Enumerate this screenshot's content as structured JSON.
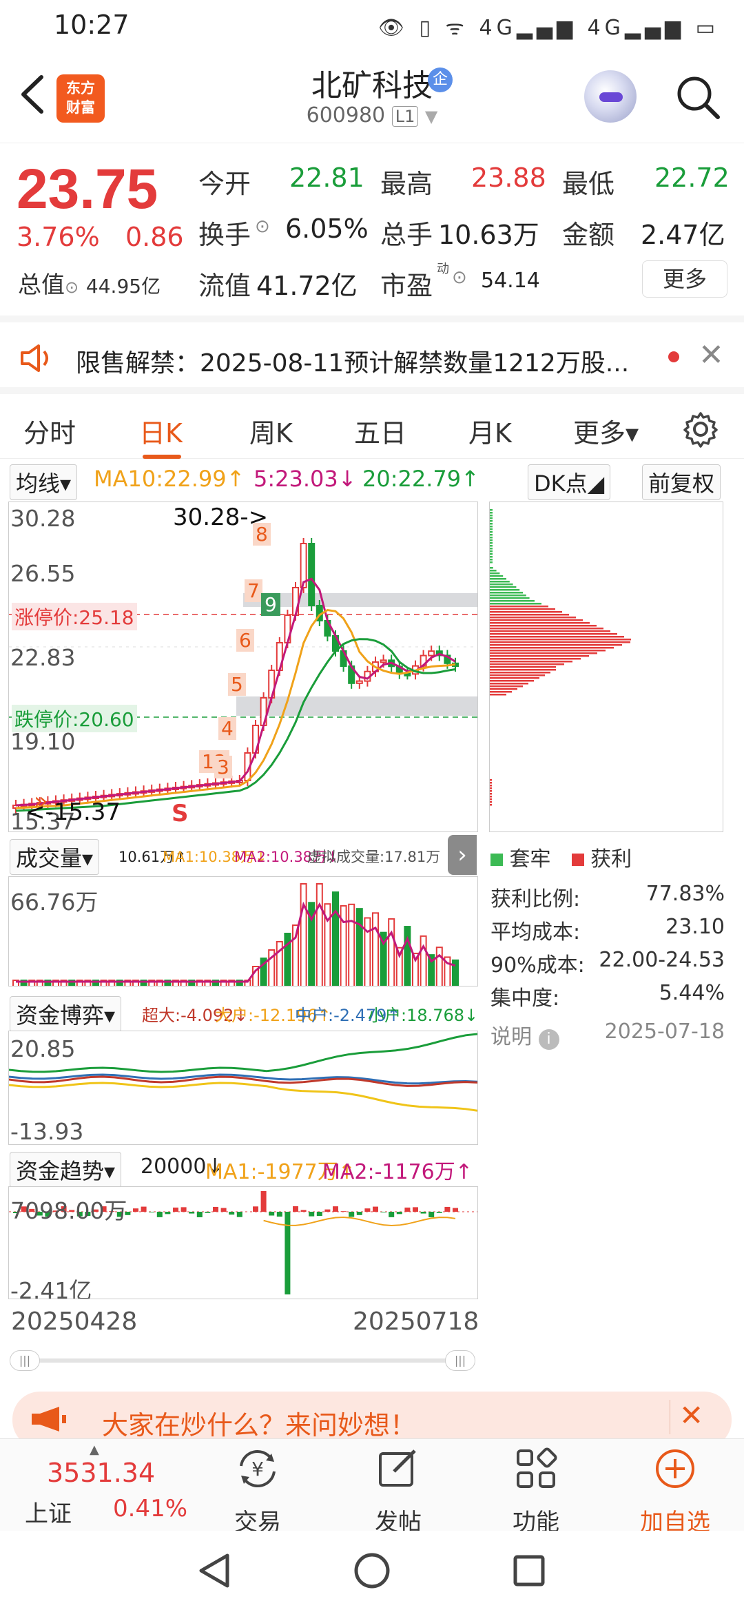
{
  "status_bar": {
    "time": "10:27",
    "icons": "👁 ▯ ᯤ 4G▂▄▆ 4G▂▄▆ ▭"
  },
  "header": {
    "stock_name": "北矿科技",
    "badge": "企",
    "code": "600980",
    "level": "L1",
    "logo_line1": "东方",
    "logo_line2": "财富"
  },
  "quote": {
    "price": "23.75",
    "change_pct": "3.76%",
    "change_amt": "0.86",
    "open_label": "今开",
    "open": "22.81",
    "high_label": "最高",
    "high": "23.88",
    "low_label": "最低",
    "low": "22.72",
    "turnover_label": "换手",
    "turnover": "6.05%",
    "volume_label": "总手",
    "volume": "10.63万",
    "amount_label": "金额",
    "amount": "2.47亿",
    "mktcap_label": "总值",
    "mktcap": "44.95亿",
    "float_label": "流值",
    "float_cap": "41.72亿",
    "pe_label": "市盈",
    "pe_sup": "动",
    "pe": "54.14",
    "more": "更多"
  },
  "notice": {
    "text": "限售解禁：2025-08-11预计解禁数量1212万股...",
    "close": "✕"
  },
  "tabs": [
    {
      "label": "分时"
    },
    {
      "label": "日K"
    },
    {
      "label": "周K"
    },
    {
      "label": "五日"
    },
    {
      "label": "月K"
    },
    {
      "label": "更多▾"
    }
  ],
  "ma_row": {
    "selector": "均线▾",
    "ma10": "MA10:22.99↑",
    "ma5": "5:23.03↓",
    "ma20": "20:22.79↑",
    "dk": "DK点◢",
    "adjust": "前复权"
  },
  "kline": {
    "ymax_label": "30.28",
    "y2_label": "26.55",
    "y3_label": "22.83",
    "y4_label": "19.10",
    "ymin_label": "15.37",
    "peak_note": "30.28->",
    "min_note": "<-15.37",
    "limit_up": "涨停价:25.18",
    "limit_down": "跌停价:20.60",
    "markers": [
      "8",
      "7",
      "9",
      "6",
      "5",
      "4",
      "12",
      "3",
      "S"
    ]
  },
  "volume": {
    "selector": "成交量▾",
    "info": "10.61万↑",
    "ma1": "MA1:10.38万↓",
    "ma2": "MA2:10.38万↓",
    "virtual": "虚拟成交量:17.81万",
    "max_label": "66.76万"
  },
  "capital_game": {
    "selector": "资金博弈▾",
    "super": "超大:-4.092↓",
    "large": "大户:-12.196↑",
    "mid": "中户:-2.479↑",
    "small": "小户:18.768↓",
    "max_label": "20.85",
    "min_label": "-13.93"
  },
  "capital_trend": {
    "selector": "资金趋势▾",
    "val": "20000↓",
    "ma1": "MA1:-1977万↑",
    "ma2": "MA2:-1176万↑",
    "max_label": "7098.00万",
    "min_label": "-2.41亿"
  },
  "dates": {
    "start": "20250428",
    "end": "20250718"
  },
  "chip": {
    "legend_trapped": "套牢",
    "legend_profit": "获利",
    "stats": [
      {
        "label": "获利比例:",
        "value": "77.83%"
      },
      {
        "label": "平均成本:",
        "value": "23.10"
      },
      {
        "label": "90%成本:",
        "value": "22.00-24.53"
      },
      {
        "label": "集中度:",
        "value": "5.44%"
      }
    ],
    "note_label": "说明",
    "note_date": "2025-07-18"
  },
  "promo": {
    "text": "大家在炒什么？来问妙想！",
    "close": "✕"
  },
  "bottom_nav": {
    "index_value": "3531.34",
    "index_name": "上证",
    "index_pct": "0.41%",
    "items": [
      {
        "label": "交易"
      },
      {
        "label": "发帖"
      },
      {
        "label": "功能"
      },
      {
        "label": "加自选"
      }
    ]
  },
  "colors": {
    "red": "#e33b3b",
    "green": "#1a9d3a",
    "accent": "#e8591a"
  }
}
